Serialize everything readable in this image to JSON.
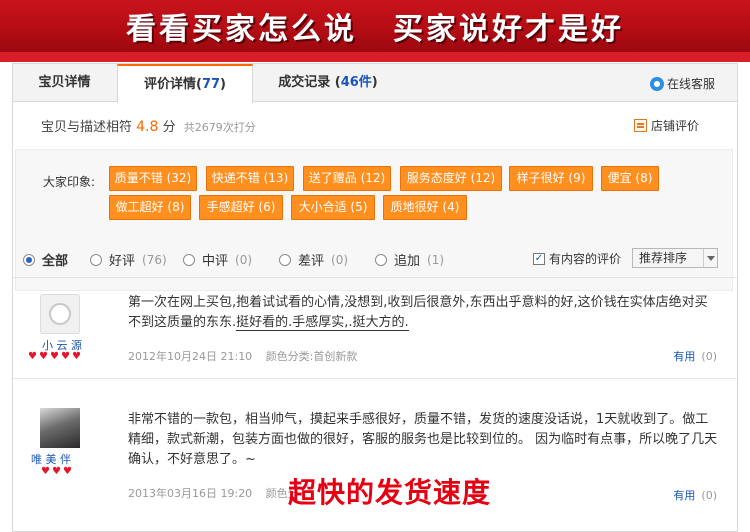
{
  "banner": {
    "left_title": "看看买家怎么说",
    "right_title": "买家说好才是好"
  },
  "tabs": [
    {
      "label": "宝贝详情",
      "count": ""
    },
    {
      "label": "评价详情(",
      "count": "77",
      "suffix": ")"
    },
    {
      "label": "成交记录 (",
      "count": "46件",
      "suffix": ")"
    }
  ],
  "service": {
    "label": "在线客服",
    "icon": "chat-bubble-icon"
  },
  "score": {
    "label": "宝贝与描述相符",
    "value": "4.8",
    "unit": "分",
    "count": "共2679次打分",
    "shop_review": "店铺评价"
  },
  "impressions": {
    "label": "大家印象:",
    "tags": [
      "质量不错 (32)",
      "快递不错 (13)",
      "送了赠品 (12)",
      "服务态度好 (12)",
      "样子很好 (9)",
      "便宜 (8)",
      "做工超好 (8)",
      "手感超好 (6)",
      "大小合适 (5)",
      "质地很好 (4)"
    ]
  },
  "filters": {
    "all": "全部",
    "good": "好评",
    "good_count": "(76)",
    "neutral": "中评",
    "neutral_count": "(0)",
    "bad": "差评",
    "bad_count": "(0)",
    "append": "追加",
    "append_count": "(1)",
    "has_content": "有内容的评价",
    "has_content_checked": true,
    "sort": "推荐排序"
  },
  "reviews": [
    {
      "nick": "小 云 源",
      "content_plain": "第一次在网上买包,抱着试试看的心情,没想到,收到后很意外,东西出乎意料的好,这价钱在实体店绝对买不到这质量的东东.",
      "content_underlined": "挺好看的.手感厚实,.挺大方的.",
      "date": "2012年10月24日 21:10",
      "attr": "颜色分类:首创新款",
      "useful": "有用",
      "useful_count": "(0)"
    },
    {
      "nick": "唯 美 伴",
      "content_plain": "非常不错的一款包，相当帅气，摸起来手感很好，质量不错，发货的速度没话说，1天就收到了。做工精细，款式新潮，包装方面也做的很好，客服的服务也是比较到位的。 因为临时有点事，所以晚了几天确认，不好意思了。~",
      "date": "2013年03月16日 19:20",
      "attr": "颜色分",
      "useful": "有用",
      "useful_count": "(0)"
    }
  ],
  "caption": "超快的发货速度",
  "colors": {
    "banner": "#c8141c",
    "tag": "#ff8f1f",
    "link": "#1a55b5",
    "accent": "#ff6600"
  }
}
